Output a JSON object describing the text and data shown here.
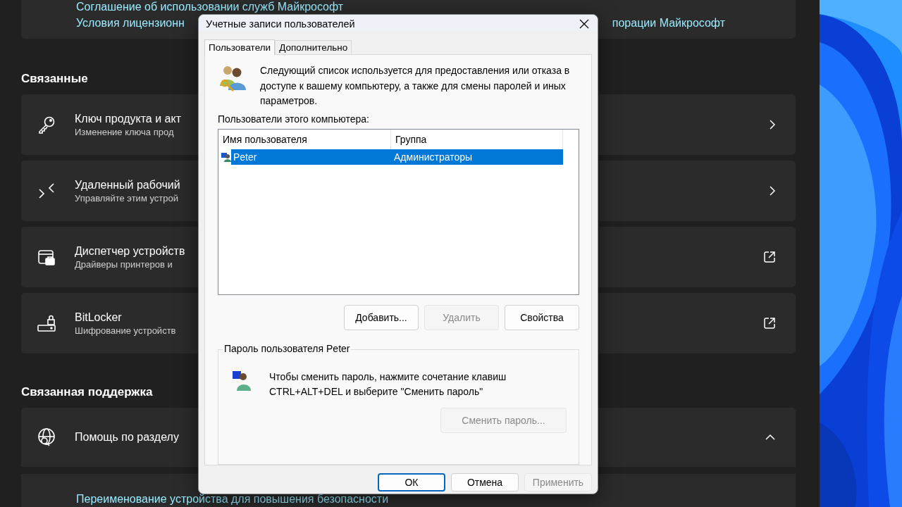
{
  "settings_page": {
    "links": [
      {
        "left": "Соглашение об использовании служб Майкрософт"
      },
      {
        "left": "Условия лицензионн",
        "right": "порации Майкрософт"
      }
    ],
    "sections": [
      {
        "heading": "Связанные",
        "items": [
          {
            "title": "Ключ продукта и акт",
            "subtitle": "Изменение ключа прод",
            "kind": "navigate"
          },
          {
            "title": "Удаленный рабочий",
            "subtitle": "Управляйте этим устрой",
            "kind": "navigate"
          },
          {
            "title": "Диспетчер устройств",
            "subtitle": "Драйверы принтеров и",
            "kind": "external"
          },
          {
            "title": "BitLocker",
            "subtitle": "Шифрование устройств",
            "kind": "external"
          }
        ]
      },
      {
        "heading": "Связанная поддержка",
        "items": [
          {
            "title": "Помощь по разделу",
            "kind": "expander",
            "expanded": true,
            "links": [
              "Переименование устройства для повышения безопасности"
            ]
          }
        ]
      }
    ]
  },
  "dialog": {
    "title": "Учетные записи пользователей",
    "tabs": [
      {
        "label": "Пользователи",
        "selected": true
      },
      {
        "label": "Дополнительно",
        "selected": false
      }
    ],
    "intro": "Следующий список используется для предоставления или отказа в доступе к вашему компьютеру, а также для смены паролей и иных параметров.",
    "list_label": "Пользователи этого компьютера:",
    "table": {
      "columns": [
        "Имя пользователя",
        "Группа"
      ],
      "rows": [
        {
          "cells": [
            "Peter",
            "Администраторы"
          ],
          "selected": true
        }
      ]
    },
    "list_buttons": [
      {
        "label": "Добавить...",
        "disabled": false
      },
      {
        "label": "Удалить",
        "disabled": true
      },
      {
        "label": "Свойства",
        "disabled": false
      }
    ],
    "password_group": {
      "title": "Пароль пользователя Peter",
      "text": "Чтобы сменить пароль, нажмите сочетание клавиш CTRL+ALT+DEL и выберите \"Сменить пароль\"",
      "button": {
        "label": "Сменить пароль...",
        "disabled": true
      }
    },
    "buttons": [
      {
        "label": "ОК",
        "disabled": false,
        "default": true
      },
      {
        "label": "Отмена",
        "disabled": false,
        "default": false
      },
      {
        "label": "Применить",
        "disabled": true,
        "default": false
      }
    ]
  }
}
